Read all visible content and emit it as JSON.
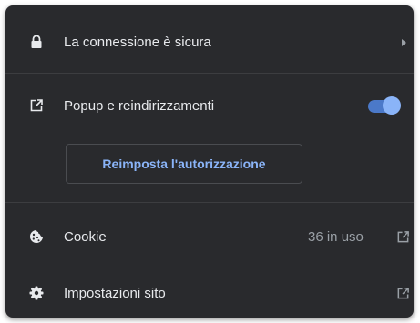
{
  "connection": {
    "label": "La connessione è sicura",
    "lock_icon": "lock-icon",
    "chevron_icon": "chevron-right-icon"
  },
  "popups": {
    "label": "Popup e reindirizzamenti",
    "icon": "open-in-new-icon",
    "enabled": true,
    "reset_label": "Reimposta l'autorizzazione"
  },
  "cookies": {
    "label": "Cookie",
    "usage": "36 in uso",
    "icon": "cookie-icon",
    "open_icon": "open-in-new-icon"
  },
  "site_settings": {
    "label": "Impostazioni sito",
    "icon": "gear-icon",
    "open_icon": "open-in-new-icon"
  },
  "colors": {
    "panel_bg": "#292a2d",
    "accent": "#8ab4f8",
    "text": "#e8eaed",
    "muted": "#9aa0a6"
  }
}
